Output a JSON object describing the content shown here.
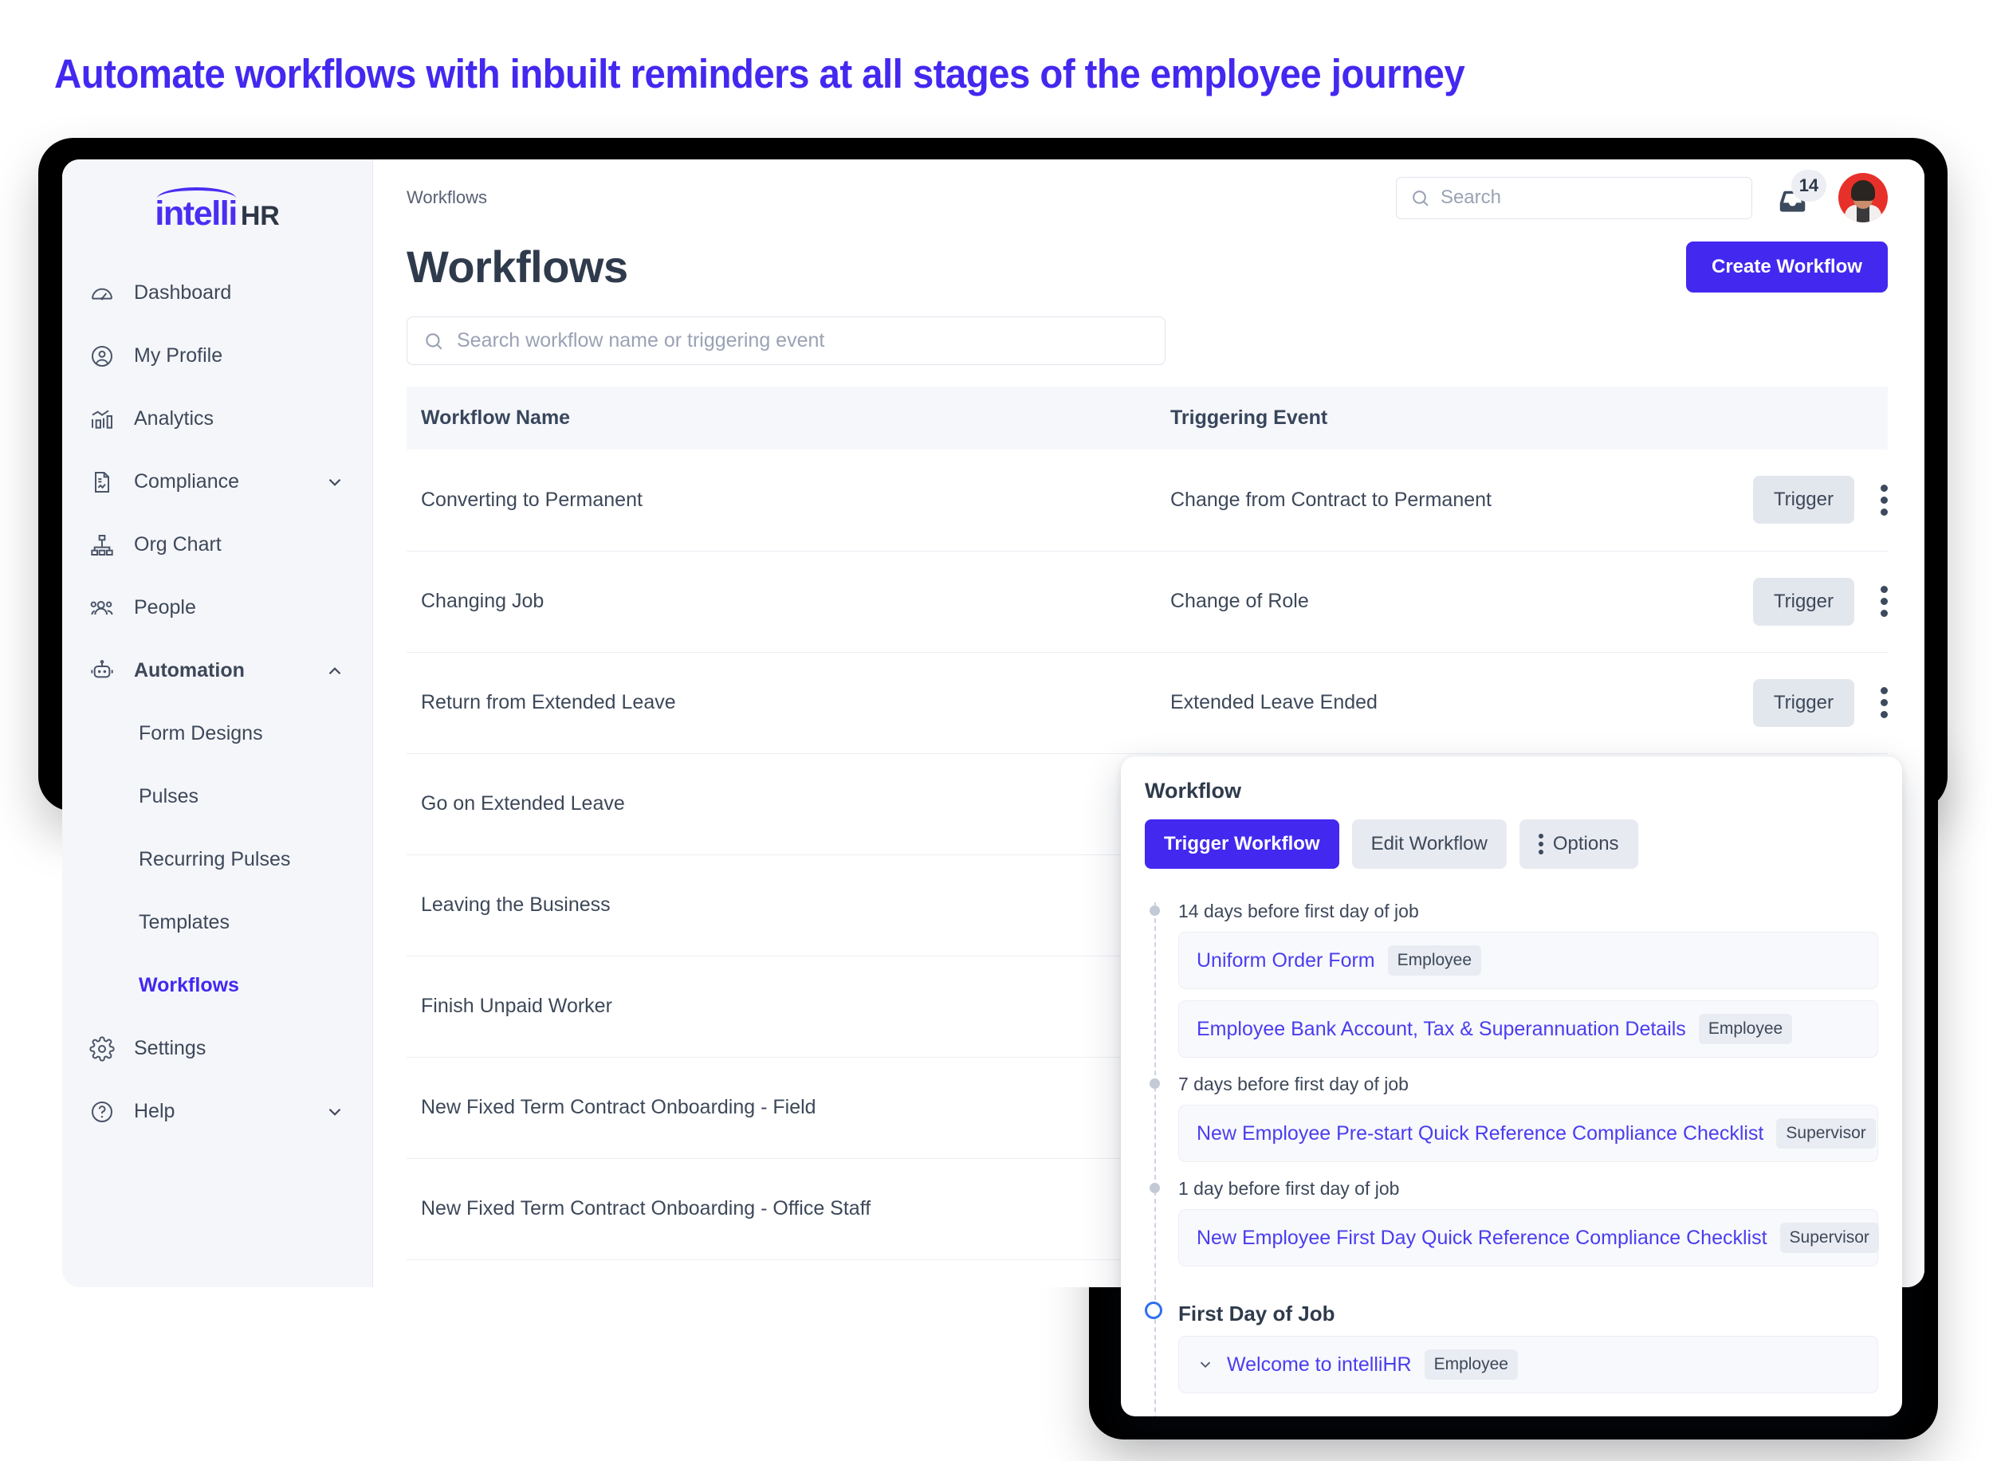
{
  "headline": "Automate workflows with inbuilt reminders at all stages of the employee journey",
  "brand": {
    "logo_primary": "intelli",
    "logo_secondary": "HR",
    "accent_color": "#4328f0",
    "headline_color": "#4328f0"
  },
  "sidebar": {
    "items": [
      {
        "label": "Dashboard",
        "icon": "gauge-icon",
        "chevron": "",
        "sub": false
      },
      {
        "label": "My Profile",
        "icon": "user-circle-icon",
        "chevron": "",
        "sub": false
      },
      {
        "label": "Analytics",
        "icon": "analytics-icon",
        "chevron": "",
        "sub": false
      },
      {
        "label": "Compliance",
        "icon": "document-icon",
        "chevron": "down",
        "sub": false
      },
      {
        "label": "Org Chart",
        "icon": "org-chart-icon",
        "chevron": "",
        "sub": false
      },
      {
        "label": "People",
        "icon": "people-icon",
        "chevron": "",
        "sub": false
      },
      {
        "label": "Automation",
        "icon": "robot-icon",
        "chevron": "up",
        "sub": false
      }
    ],
    "sub_items": [
      {
        "label": "Form Designs",
        "active": false
      },
      {
        "label": "Pulses",
        "active": false
      },
      {
        "label": "Recurring Pulses",
        "active": false
      },
      {
        "label": "Templates",
        "active": false
      },
      {
        "label": "Workflows",
        "active": true
      }
    ],
    "bottom_items": [
      {
        "label": "Settings",
        "icon": "gear-icon",
        "chevron": ""
      },
      {
        "label": "Help",
        "icon": "question-circle-icon",
        "chevron": "down"
      }
    ]
  },
  "topbar": {
    "breadcrumb": "Workflows",
    "search_placeholder": "Search",
    "notification_count": "14"
  },
  "page": {
    "title": "Workflows",
    "create_button": "Create Workflow",
    "filter_placeholder": "Search workflow name or triggering event"
  },
  "table": {
    "headers": [
      "Workflow Name",
      "Triggering Event",
      ""
    ],
    "trigger_label": "Trigger",
    "rows": [
      {
        "name": "Converting to Permanent",
        "event": "Change from Contract to Permanent",
        "has_action": true
      },
      {
        "name": "Changing Job",
        "event": "Change of Role",
        "has_action": true
      },
      {
        "name": "Return from Extended Leave",
        "event": "Extended Leave Ended",
        "has_action": true
      },
      {
        "name": "Go on Extended Leave",
        "event": "",
        "has_action": false
      },
      {
        "name": "Leaving the Business",
        "event": "",
        "has_action": false
      },
      {
        "name": "Finish Unpaid Worker",
        "event": "",
        "has_action": false
      },
      {
        "name": "New Fixed Term Contract Onboarding - Field",
        "event": "",
        "has_action": false
      },
      {
        "name": "New Fixed Term Contract Onboarding - Office Staff",
        "event": "",
        "has_action": false
      }
    ]
  },
  "popup": {
    "title": "Workflow",
    "actions": [
      {
        "label": "Trigger Workflow",
        "style": "primary"
      },
      {
        "label": "Edit Workflow",
        "style": "ghost"
      },
      {
        "label": "Options",
        "style": "ghost",
        "icon": "kebab-icon"
      }
    ],
    "timeline": [
      {
        "label": "14 days before first day of job",
        "marker": "dot",
        "items": [
          {
            "title": "Uniform Order Form",
            "tag": "Employee",
            "expandable": false
          },
          {
            "title": "Employee Bank Account, Tax & Superannuation Details",
            "tag": "Employee",
            "expandable": false
          }
        ]
      },
      {
        "label": "7 days before first day of job",
        "marker": "dot",
        "items": [
          {
            "title": "New Employee Pre-start Quick Reference Compliance Checklist",
            "tag": "Supervisor",
            "expandable": false
          }
        ]
      },
      {
        "label": "1 day before first day of job",
        "marker": "dot",
        "items": [
          {
            "title": "New Employee First Day Quick Reference Compliance Checklist",
            "tag": "Supervisor",
            "expandable": false
          }
        ]
      },
      {
        "label": "First Day of Job",
        "marker": "ring",
        "major": true,
        "items": [
          {
            "title": "Welcome to intelliHR",
            "tag": "Employee",
            "expandable": true
          }
        ]
      }
    ]
  }
}
